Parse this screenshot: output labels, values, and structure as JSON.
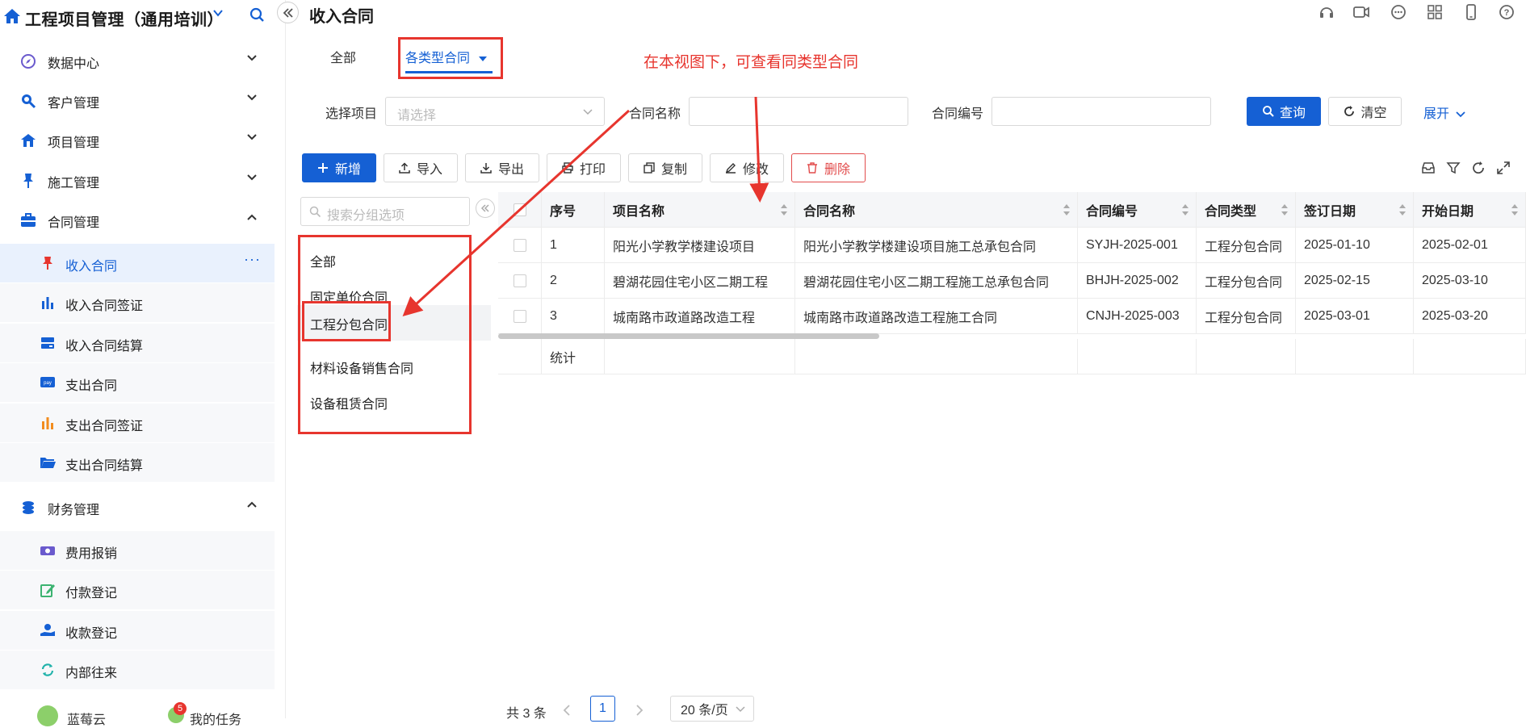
{
  "app": {
    "title": "工程项目管理（通用培训）"
  },
  "sidebar": {
    "groups": [
      {
        "label": "数据中心",
        "icon": "compass-icon",
        "expanded": false
      },
      {
        "label": "客户管理",
        "icon": "customer-search-icon",
        "expanded": false
      },
      {
        "label": "项目管理",
        "icon": "project-house-icon",
        "expanded": false
      },
      {
        "label": "施工管理",
        "icon": "pushpin-icon",
        "expanded": false
      },
      {
        "label": "合同管理",
        "icon": "briefcase-icon",
        "expanded": true
      },
      {
        "label": "财务管理",
        "icon": "coins-icon",
        "expanded": true
      }
    ],
    "contract_items": [
      {
        "label": "收入合同",
        "icon": "red-pin-icon",
        "active": true
      },
      {
        "label": "收入合同签证",
        "icon": "bar-chart-icon"
      },
      {
        "label": "收入合同结算",
        "icon": "card-icon"
      },
      {
        "label": "支出合同",
        "icon": "pay-icon"
      },
      {
        "label": "支出合同签证",
        "icon": "orange-bar-chart-icon"
      },
      {
        "label": "支出合同结算",
        "icon": "folder-open-icon"
      }
    ],
    "finance_items": [
      {
        "label": "费用报销",
        "icon": "money-icon"
      },
      {
        "label": "付款登记",
        "icon": "edit-icon"
      },
      {
        "label": "收款登记",
        "icon": "hand-coin-icon"
      },
      {
        "label": "内部往来",
        "icon": "refresh-icon"
      }
    ],
    "more_label": "···",
    "user": {
      "name": "蓝莓云",
      "tasks_label": "我的任务",
      "tasks_badge": "5"
    }
  },
  "header": {
    "page_title": "收入合同",
    "icons": [
      "headset-icon",
      "video-icon",
      "chat-icon",
      "grid-icon",
      "phone-icon",
      "help-icon"
    ]
  },
  "tabs": [
    {
      "label": "全部",
      "active": false
    },
    {
      "label": "各类型合同",
      "active": true
    }
  ],
  "annotation": "在本视图下，可查看同类型合同",
  "filter": {
    "project_label": "选择项目",
    "project_placeholder": "请选择",
    "name_label": "合同名称",
    "code_label": "合同编号",
    "query_label": "查询",
    "clear_label": "清空",
    "expand_label": "展开"
  },
  "toolbar": {
    "new_label": "新增",
    "import_label": "导入",
    "export_label": "导出",
    "print_label": "打印",
    "copy_label": "复制",
    "edit_label": "修改",
    "delete_label": "删除"
  },
  "groups": {
    "search_placeholder": "搜索分组选项",
    "items": [
      "全部",
      "固定单价合同",
      "工程分包合同",
      "材料设备销售合同",
      "设备租赁合同"
    ],
    "selected_index": 2
  },
  "table": {
    "columns": [
      "序号",
      "项目名称",
      "合同名称",
      "合同编号",
      "合同类型",
      "签订日期",
      "开始日期"
    ],
    "rows": [
      [
        "1",
        "阳光小学教学楼建设项目",
        "阳光小学教学楼建设项目施工总承包合同",
        "SYJH-2025-001",
        "工程分包合同",
        "2025-01-10",
        "2025-02-01"
      ],
      [
        "2",
        "碧湖花园住宅小区二期工程",
        "碧湖花园住宅小区二期工程施工总承包合同",
        "BHJH-2025-002",
        "工程分包合同",
        "2025-02-15",
        "2025-03-10"
      ],
      [
        "3",
        "城南路市政道路改造工程",
        "城南路市政道路改造工程施工合同",
        "CNJH-2025-003",
        "工程分包合同",
        "2025-03-01",
        "2025-03-20"
      ]
    ],
    "summary_label": "统计"
  },
  "pagination": {
    "total_label": "共 3 条",
    "current_page": "1",
    "page_size_label": "20 条/页"
  },
  "colors": {
    "primary": "#1560d4",
    "annotation_red": "#e7352e",
    "danger": "#e24c4c"
  }
}
